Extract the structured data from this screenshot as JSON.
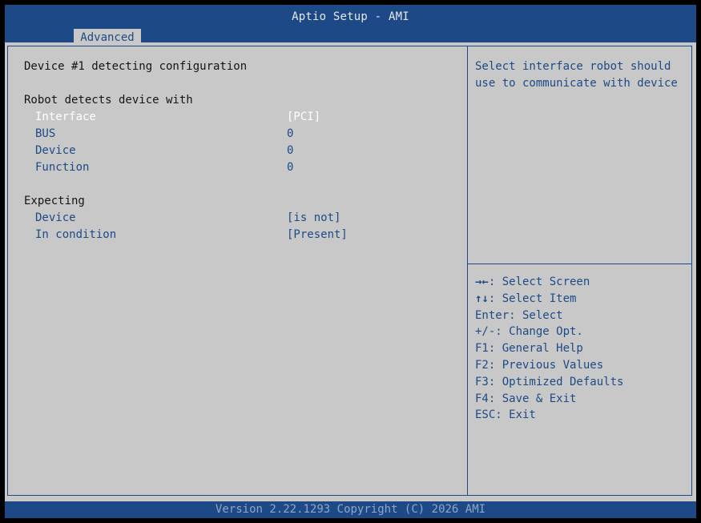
{
  "header": {
    "title": "Aptio Setup - AMI",
    "active_tab": "Advanced"
  },
  "main": {
    "section_title": "Device #1 detecting configuration",
    "group1_heading": "Robot detects device with",
    "group1_items": [
      {
        "label": "Interface",
        "value": "[PCI]"
      },
      {
        "label": "BUS",
        "value": "0"
      },
      {
        "label": "Device",
        "value": "0"
      },
      {
        "label": "Function",
        "value": "0"
      }
    ],
    "group2_heading": "Expecting",
    "group2_items": [
      {
        "label": "Device",
        "value": "[is not]"
      },
      {
        "label": "In condition",
        "value": "[Present]"
      }
    ]
  },
  "help": {
    "text": "Select interface robot should use to communicate with device"
  },
  "key_legend": [
    {
      "key": "→←",
      "desc": ": Select Screen"
    },
    {
      "key": "↑↓",
      "desc": ": Select Item"
    },
    {
      "key": "",
      "desc": "Enter: Select"
    },
    {
      "key": "",
      "desc": "+/-: Change Opt."
    },
    {
      "key": "",
      "desc": "F1: General Help"
    },
    {
      "key": "",
      "desc": "F2: Previous Values"
    },
    {
      "key": "",
      "desc": "F3: Optimized Defaults"
    },
    {
      "key": "",
      "desc": "F4: Save & Exit"
    },
    {
      "key": "",
      "desc": "ESC: Exit"
    }
  ],
  "footer": {
    "text": "Version 2.22.1293 Copyright (C) 2026 AMI"
  },
  "colors": {
    "bios_blue": "#1d4a87",
    "panel_gray": "#c8c8c8",
    "highlight_white": "#ffffff"
  }
}
